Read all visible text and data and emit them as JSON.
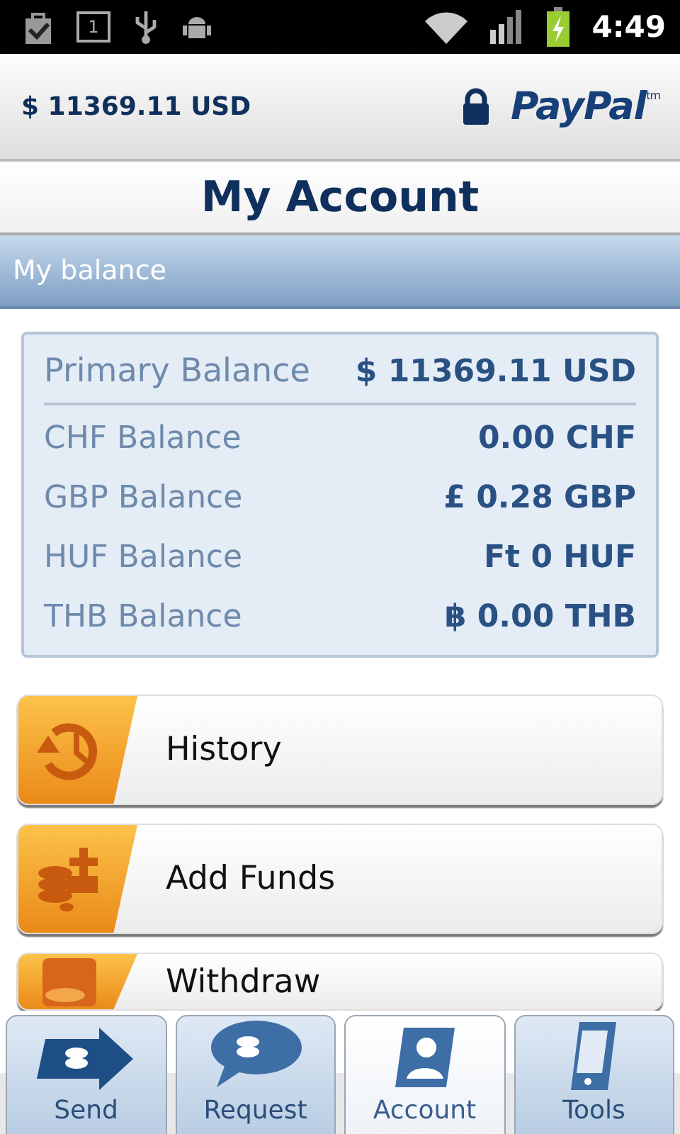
{
  "status_bar": {
    "calendar_day": "1",
    "time": "4:49"
  },
  "header": {
    "balance": "$ 11369.11 USD",
    "logo": "PayPal$^{tm}$"
  },
  "title": "My Account",
  "section": "My balance",
  "balances": [
    {
      "kind": "primary",
      "label": "Primary Balance",
      "amount": "$ 11369.11 USD"
    },
    {
      "kind": "currency",
      "label": "CHF Balance",
      "amount": "0.00 CHF"
    },
    {
      "kind": "currency",
      "label": "GBP Balance",
      "amount": "£ 0.28 GBP"
    },
    {
      "kind": "currency",
      "label": "HUF Balance",
      "amount": "Ft 0 HUF"
    },
    {
      "kind": "currency",
      "label": "THB Balance",
      "amount": "฿ 0.00 THB"
    }
  ],
  "menu": [
    {
      "kind": "history",
      "label": "History"
    },
    {
      "kind": "add_funds",
      "label": "Add Funds"
    },
    {
      "kind": "withdraw",
      "label": "Withdraw"
    }
  ],
  "tabs": [
    {
      "kind": "send",
      "label": "Send",
      "selected": false
    },
    {
      "kind": "request",
      "label": "Request",
      "selected": false
    },
    {
      "kind": "account",
      "label": "Account",
      "selected": true
    },
    {
      "kind": "tools",
      "label": "Tools",
      "selected": false
    }
  ]
}
